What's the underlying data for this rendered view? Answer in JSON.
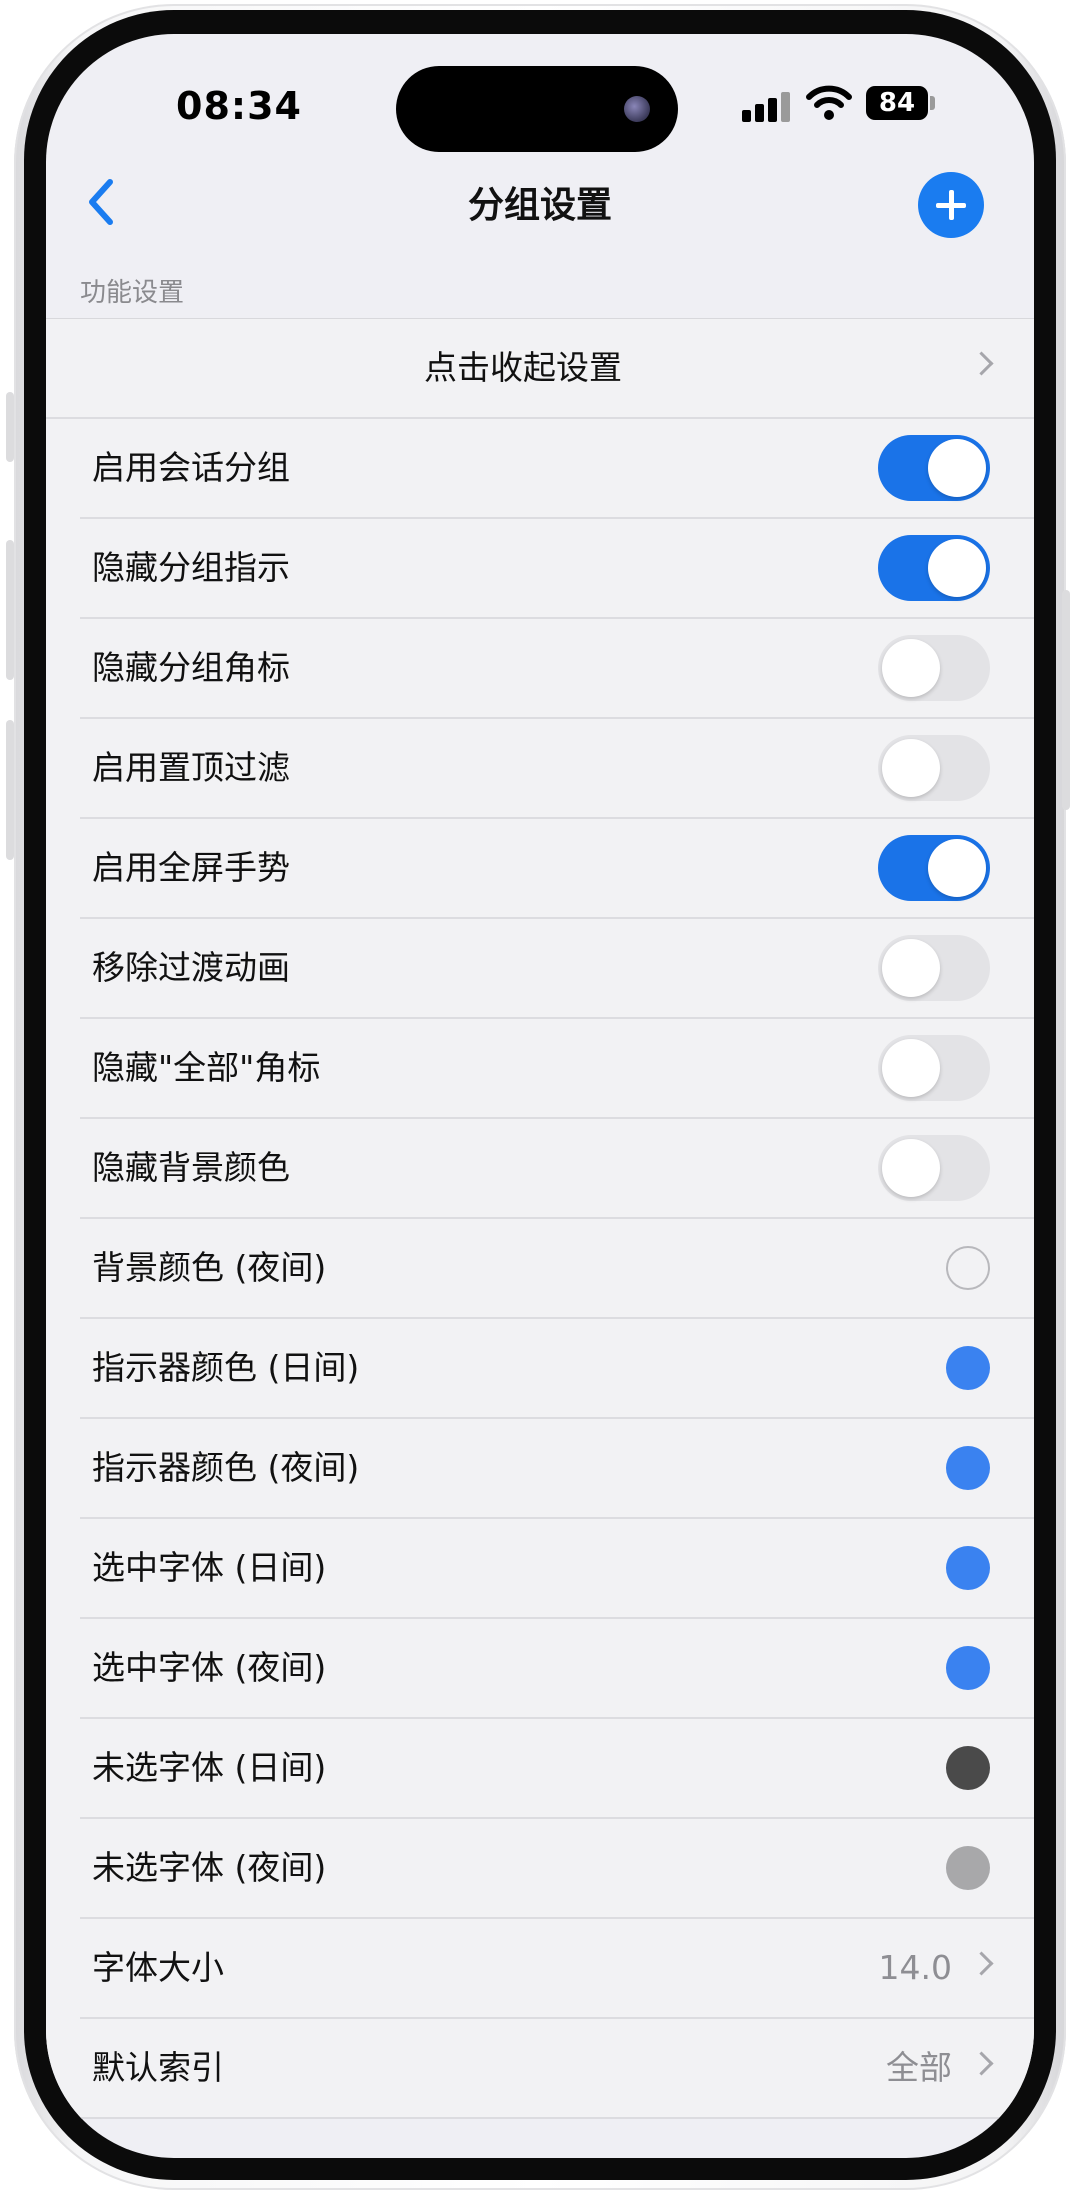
{
  "status": {
    "time": "08:34",
    "battery": "84"
  },
  "nav": {
    "title": "分组设置"
  },
  "section": {
    "header": "功能设置"
  },
  "collapse_row": {
    "label": "点击收起设置"
  },
  "toggles": [
    {
      "label": "启用会话分组",
      "on": true
    },
    {
      "label": "隐藏分组指示",
      "on": true
    },
    {
      "label": "隐藏分组角标",
      "on": false
    },
    {
      "label": "启用置顶过滤",
      "on": false
    },
    {
      "label": "启用全屏手势",
      "on": true
    },
    {
      "label": "移除过渡动画",
      "on": false
    },
    {
      "label": "隐藏\"全部\"角标",
      "on": false
    },
    {
      "label": "隐藏背景颜色",
      "on": false
    }
  ],
  "colors": [
    {
      "label": "背景颜色 (夜间)",
      "color": "#f2f2f4",
      "outlined": true
    },
    {
      "label": "指示器颜色 (日间)",
      "color": "#3a82f0",
      "outlined": false
    },
    {
      "label": "指示器颜色 (夜间)",
      "color": "#3a82f0",
      "outlined": false
    },
    {
      "label": "选中字体 (日间)",
      "color": "#3a82f0",
      "outlined": false
    },
    {
      "label": "选中字体 (夜间)",
      "color": "#3a82f0",
      "outlined": false
    },
    {
      "label": "未选字体 (日间)",
      "color": "#4a4a4a",
      "outlined": false
    },
    {
      "label": "未选字体 (夜间)",
      "color": "#a8a8aa",
      "outlined": false
    }
  ],
  "value_rows": [
    {
      "label": "字体大小",
      "value": "14.0"
    },
    {
      "label": "默认索引",
      "value": "全部"
    }
  ]
}
